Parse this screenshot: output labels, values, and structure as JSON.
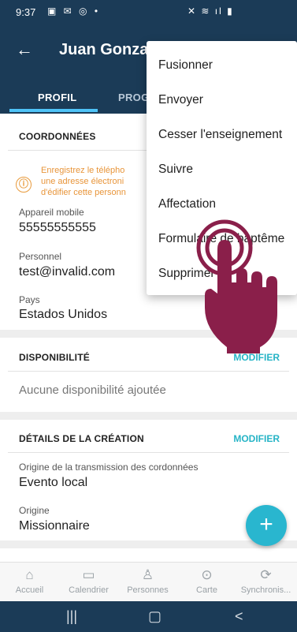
{
  "status_bar": {
    "time": "9:37",
    "left_icons": "▣ ✉ ◎ •",
    "right_icons": "✕ ≋ ıl ▮"
  },
  "app_bar": {
    "back_glyph": "←",
    "title": "Juan Gonzal",
    "tabs": [
      {
        "label": "PROFIL",
        "active": true
      },
      {
        "label": "PROG",
        "active": false
      }
    ]
  },
  "contact_section": {
    "title": "COORDONNÉES",
    "warning_icon": "ⓘ",
    "warning_lines": [
      "Enregistrez le télépho",
      "une adresse électroni",
      "d'édifier cette personn"
    ],
    "fields": [
      {
        "label": "Appareil mobile",
        "value": "55555555555"
      },
      {
        "label": "Personnel",
        "value": "test@invalid.com"
      },
      {
        "label": "Pays",
        "value": "Estados Unidos"
      }
    ]
  },
  "availability_section": {
    "title": "DISPONIBILITÉ",
    "edit_label": "MODIFIER",
    "empty_text": "Aucune disponibilité ajoutée"
  },
  "creation_section": {
    "title": "DÉTAILS DE LA CRÉATION",
    "edit_label": "MODIFIER",
    "fields": [
      {
        "label": "Origine de la transmission des cordonnées",
        "value": "Evento local"
      },
      {
        "label": "Origine",
        "value": "Missionnaire"
      }
    ]
  },
  "fab": {
    "glyph": "+"
  },
  "bottom_nav": [
    {
      "label": "Accueil",
      "icon": "home-icon",
      "glyph": "⌂"
    },
    {
      "label": "Calendrier",
      "icon": "calendar-icon",
      "glyph": "▭"
    },
    {
      "label": "Personnes",
      "icon": "person-icon",
      "glyph": "♙"
    },
    {
      "label": "Carte",
      "icon": "map-pin-icon",
      "glyph": "⊙"
    },
    {
      "label": "Synchronis...",
      "icon": "sync-icon",
      "glyph": "⟳"
    }
  ],
  "system_nav": {
    "recents": "|||",
    "home": "▢",
    "back": "<"
  },
  "overflow_menu": {
    "items": [
      "Fusionner",
      "Envoyer",
      "Cesser l'enseignement",
      "Suivre",
      "Affectation",
      "Formulaire de baptême",
      "Supprimer"
    ]
  },
  "colors": {
    "primary": "#1b3b57",
    "accent": "#26b4c6",
    "warning": "#e8953a",
    "hand": "#8a1f4a"
  }
}
